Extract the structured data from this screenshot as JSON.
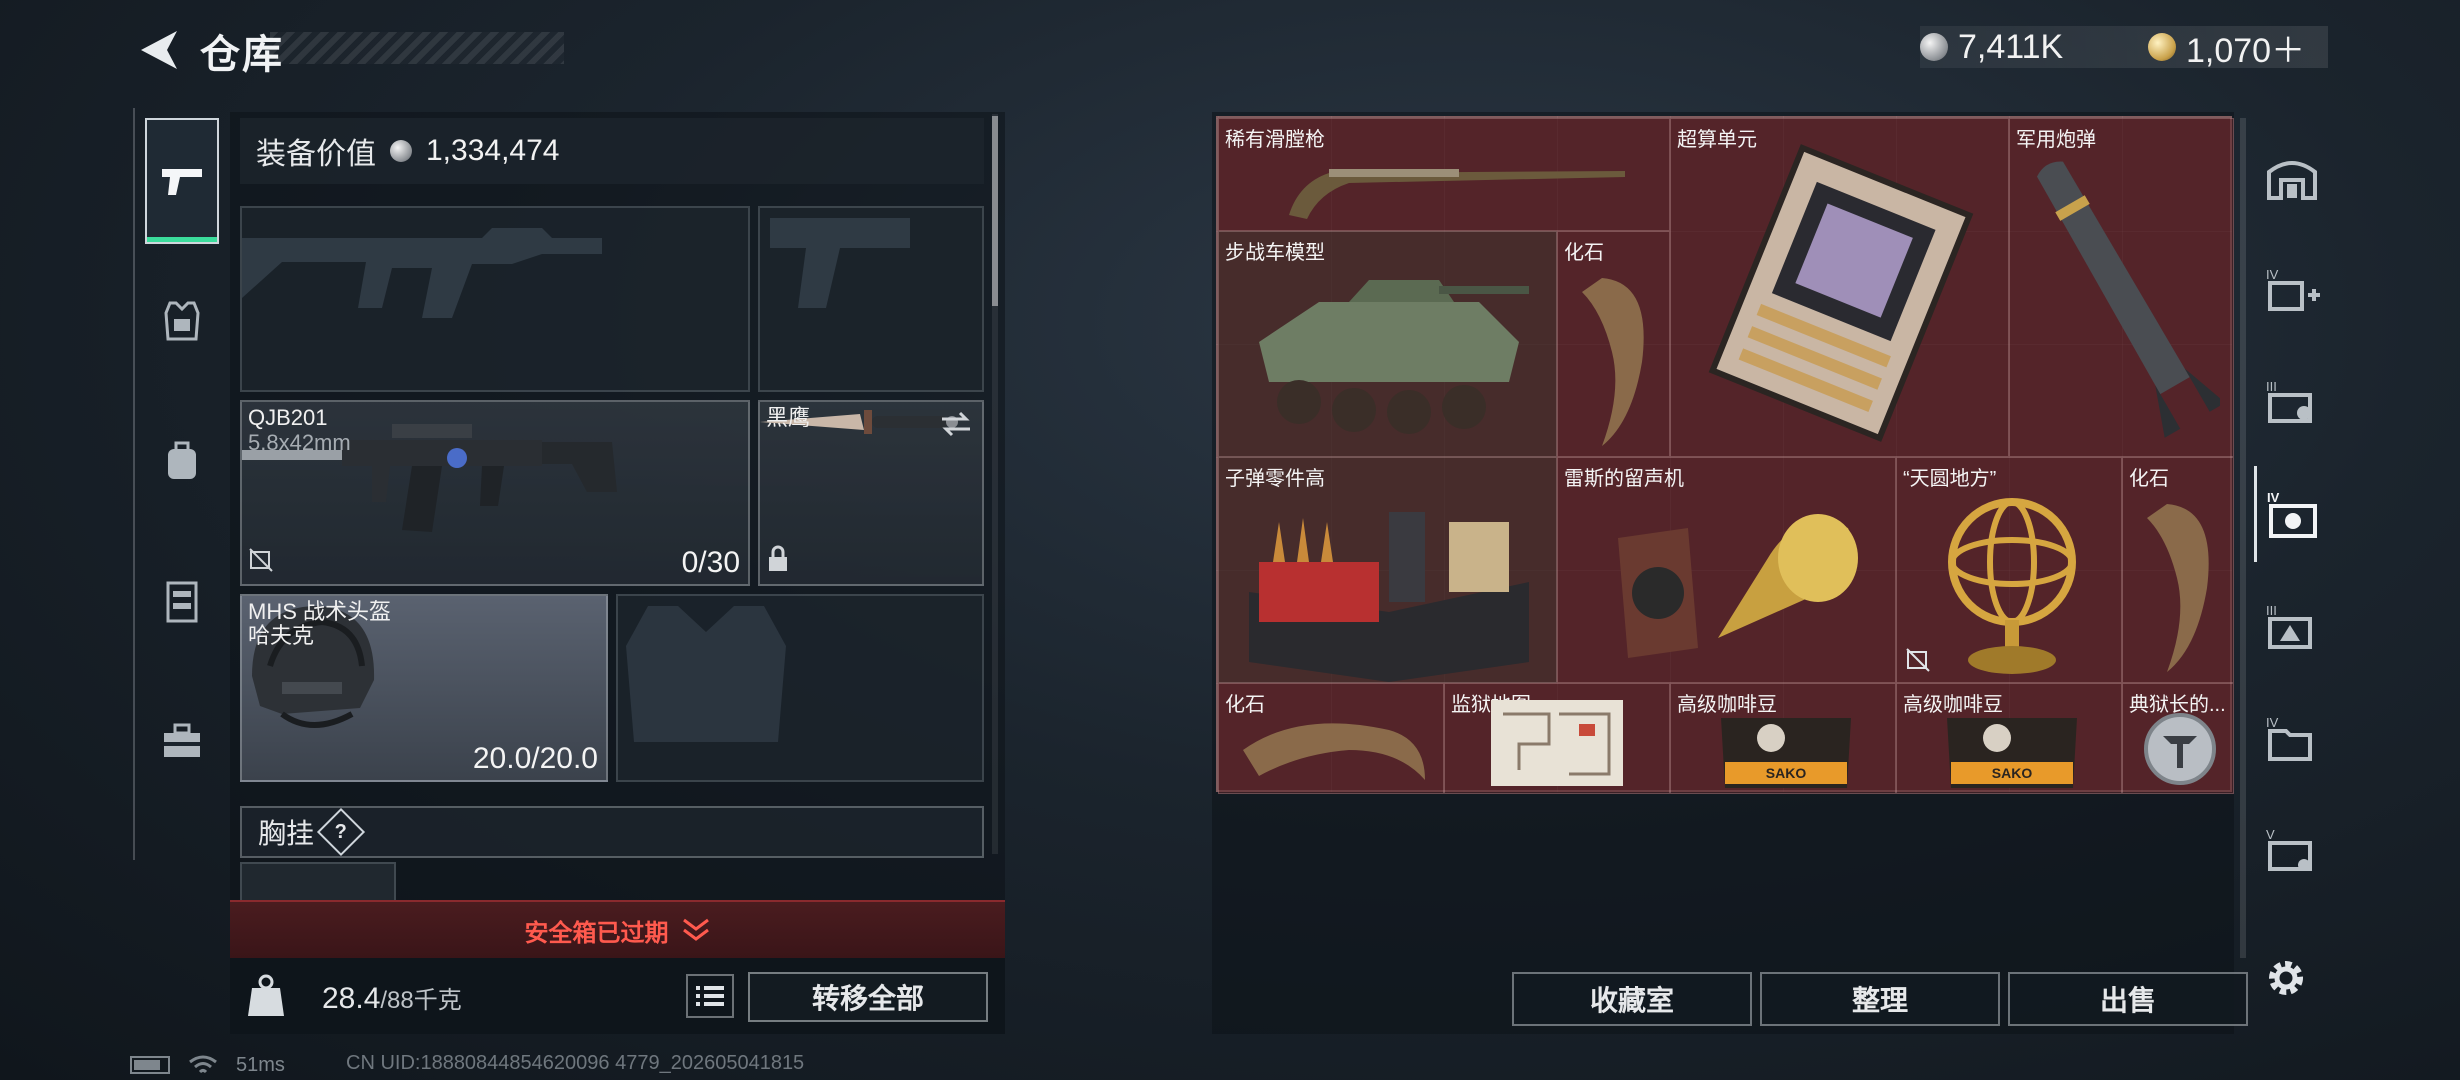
{
  "header": {
    "title": "仓库"
  },
  "currency": {
    "silver": "7,411K",
    "gold": "1,070＋"
  },
  "loadout": {
    "equip_value_label": "装备价值",
    "equip_value": "1,334,474",
    "primary_weapon": {
      "name": "QJB201",
      "caliber": "5.8x42mm",
      "ammo": "0/30"
    },
    "melee": {
      "name": "黑鹰"
    },
    "helmet": {
      "name": "MHS 战术头盔",
      "sub": "哈夫克",
      "durability": "20.0/20.0"
    },
    "chest_rig_label": "胸挂",
    "chest_rig_help": "?",
    "safe_box_banner": "安全箱已过期",
    "weight": "28.4",
    "weight_cap": "/88千克",
    "transfer_all": "转移全部"
  },
  "storage": {
    "items": [
      {
        "name": "稀有滑膛枪"
      },
      {
        "name": "超算单元"
      },
      {
        "name": "军用炮弹"
      },
      {
        "name": "步战车模型"
      },
      {
        "name": "化石"
      },
      {
        "name": "子弹零件高"
      },
      {
        "name": "雷斯的留声机"
      },
      {
        "name": "“天圆地方”"
      },
      {
        "name": "化石"
      },
      {
        "name": "化石"
      },
      {
        "name": "监狱地图..."
      },
      {
        "name": "高级咖啡豆"
      },
      {
        "name": "高级咖啡豆"
      },
      {
        "name": "典狱长的..."
      }
    ],
    "coffee_brand": "SAKO",
    "buttons": {
      "collection": "收藏室",
      "sort": "整理",
      "sell": "出售"
    }
  },
  "status": {
    "ping": "51ms",
    "uid": "CN UID:18880844854620096 4779_202605041815"
  },
  "colors": {
    "accent_green": "#3bdc9c",
    "warning_red": "#ff5a4e",
    "grid_bg": "#4b2226"
  }
}
